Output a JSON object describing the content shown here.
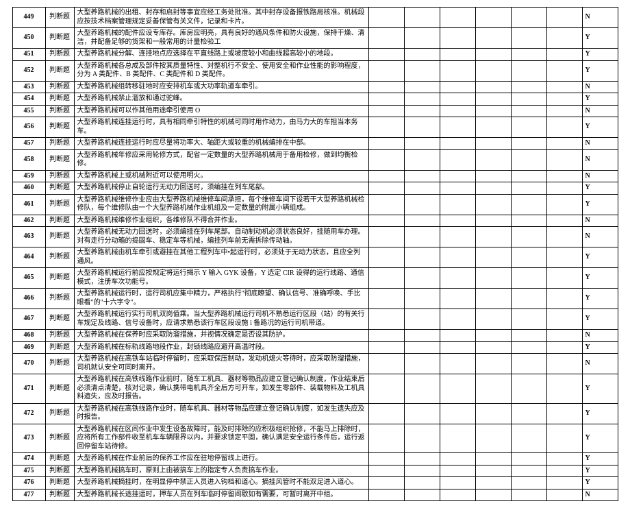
{
  "type_label": "判断题",
  "rows": [
    {
      "id": "449",
      "q": "大型养路机械的出租、封存和启封等事宜应经工务处批准。其中封存设备报铁路局核准。机械段应按技术档案管理规定妥善保管有关文件，记录和卡片。",
      "a": "N"
    },
    {
      "id": "450",
      "q": "大型养路机械的配件应设专库存。库房应明亮，具有良好的通风条件和防火设施，保持干燥、清洁，并配备足够的货架和一般常用的计量检验工",
      "a": "Y"
    },
    {
      "id": "451",
      "q": "大型养路机械分解、连挂地点应选择在平直线路上或坡度较小和曲线超高较小的地段。",
      "a": "Y"
    },
    {
      "id": "452",
      "q": "大型养路机械各总成及部件按其质量特性、对整机行不安全、使用安全和作业性能的影响程度，分为 A 类配件、B 类配件、C 类配件和 D 类配件。",
      "a": "Y"
    },
    {
      "id": "453",
      "q": "大型养路机械组转移驻地时应安排机车或大功率轨道车牵引。",
      "a": "N"
    },
    {
      "id": "454",
      "q": "大型养路机械禁止溜放和通过驼峰。",
      "a": "Y"
    },
    {
      "id": "455",
      "q": "大型养路机械可以作其他用途牵引使用 O",
      "a": "N"
    },
    {
      "id": "456",
      "q": "大型养路机械连挂运行时，具有相同牵引特性的机械可同时用作动力，由马力大的车担当本务车。",
      "a": "Y"
    },
    {
      "id": "457",
      "q": "大型养路机械连挂运行时应尽量将功率大、轴距大或较重的机械编排在中部。",
      "a": "N"
    },
    {
      "id": "458",
      "q": "大型养路机械年修应采用轮修方式，配省一定数量的大型养路机械用于备用检修，做到均衡检修。",
      "a": "N"
    },
    {
      "id": "459",
      "q": "大型养路机械上或机械附近可以使用明火。",
      "a": "N"
    },
    {
      "id": "460",
      "q": "大型养路机械停止自轮运行无动力回送时，须编挂在列车尾部。",
      "a": "Y"
    },
    {
      "id": "461",
      "q": "大型养路机械维修作业应由大型养路机械维修车间承担，每个维修车间下设若干大型养路机械检修队，每个维修队由一个大型养路机械作业机组及一定数量的附属小辆组成。",
      "a": "Y"
    },
    {
      "id": "462",
      "q": "大型养路机械维修作业组织，各维修队不得合并作业。",
      "a": "N"
    },
    {
      "id": "463",
      "q": "大型养路机械无动力回送时，必须编挂在列车尾部。自动制动机必须状态良好，挂随用车办理。对有走行分动箱的捣固车、稳定车等机械，编挂列车前无需拆除传动轴。",
      "a": "N"
    },
    {
      "id": "464",
      "q": "大型养路机械由机车牵引或避挂在其他工程列车中•起运行时，必须处于无动力状态，且应全列通风。",
      "a": "Y"
    },
    {
      "id": "465",
      "q": "大型养路机械运行前应按规定将运行揭示 Y 输入 GYK 设备，Y 选定 CIR 设得的运行线路、通信模式，注册车次功能号。",
      "a": "Y"
    },
    {
      "id": "466",
      "q": "大型养路机械运行时，运行司机应集中精力，严格执行\"彻底瞭望、确认信号、准确呼唤、手比眼看\"的\"十六字令\"。",
      "a": "Y"
    },
    {
      "id": "467",
      "q": "大型养路机械运行实行司机双岗值乘。当大型养路机械运行司机不熟悉运行区段（站）的有关行车规定及线路、信号设备时，应请求熟悉该行车区段设施 i 备路况的运行司机带道。",
      "a": "Y"
    },
    {
      "id": "468",
      "q": "大型养路机械在保养时应采取防溜措施，并视情况确定是否设其防护。",
      "a": "N"
    },
    {
      "id": "469",
      "q": "大型养路机械在标轨线路地段作业，封锁线路应避开高温时段。",
      "a": "Y"
    },
    {
      "id": "470",
      "q": "大型养路机械在高铁车站临时停留时，应采取保压制动，发动机熄火等待时，应采取防溜措施，司机就认安全可同时离开。",
      "a": "N"
    },
    {
      "id": "471",
      "q": "大型养路机械在高铁线路作业前时，随车工机具、器材等物品应建立登记确认制度，作业结束后必须清点清楚，核对记录，确认携带电机具齐全后方可开车，如发生零部件、装载物料及工机具料遗失，应及时报告。",
      "a": "Y"
    },
    {
      "id": "472",
      "q": "大型养路机械在高铁线路作业时，随车机具、器材等物品应建立登记确认制度，如发生遗失应及时报告。",
      "a": "Y"
    },
    {
      "id": "473",
      "q": "大型养路机械在区间作业中发生设备故障时，能及时排除的应积极组织抢修，不能马上排除时，应将所有工作部件收至机车车辆限界以内，并要求锁定平固，确认满足安全运行条件后，运行返回停留车站待修。",
      "a": "Y"
    },
    {
      "id": "474",
      "q": "大型养路机械在作业前后的保养工作应在驻地停留线上进行。",
      "a": "Y"
    },
    {
      "id": "475",
      "q": "大型养路机械搞车时，原则上由被搞车上的指定专人负责搞车作业。",
      "a": "Y"
    },
    {
      "id": "476",
      "q": "大型养路机械摘挂时，在明显停中禁正人员进入钩档和道心。摘挂风管时不能双足进入道心。",
      "a": "Y"
    },
    {
      "id": "477",
      "q": "大型养路机械长途挂运时，押车人员在列车临时停留间歇如有需要，可暂时离开中组。",
      "a": "N"
    }
  ]
}
